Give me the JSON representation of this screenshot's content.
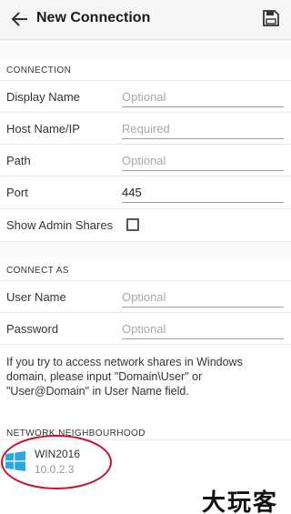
{
  "appbar": {
    "title": "New Connection",
    "back_icon": "arrow-left-icon",
    "save_icon": "save-disk-icon"
  },
  "connection": {
    "section_label": "CONNECTION",
    "display_name": {
      "label": "Display Name",
      "placeholder": "Optional"
    },
    "host": {
      "label": "Host Name/IP",
      "placeholder": "Required"
    },
    "path": {
      "label": "Path",
      "placeholder": "Optional"
    },
    "port": {
      "label": "Port",
      "value": "445"
    },
    "admin_shares": {
      "label": "Show Admin Shares",
      "checked": false
    }
  },
  "connect_as": {
    "section_label": "CONNECT AS",
    "user_name": {
      "label": "User Name",
      "placeholder": "Optional"
    },
    "password": {
      "label": "Password",
      "placeholder": "Optional"
    },
    "hint": "If you try to access network shares in Windows domain, please input \"Domain\\User\" or \"User@Domain\" in User Name field."
  },
  "neighbourhood": {
    "section_label": "NETWORK NEIGHBOURHOOD",
    "devices": [
      {
        "name": "WIN2016",
        "address": "10.0.2.3",
        "icon": "windows-logo-icon"
      }
    ]
  },
  "watermark": "大玩客",
  "colors": {
    "accent": "#2aa8df",
    "annotation": "#c8102e"
  }
}
